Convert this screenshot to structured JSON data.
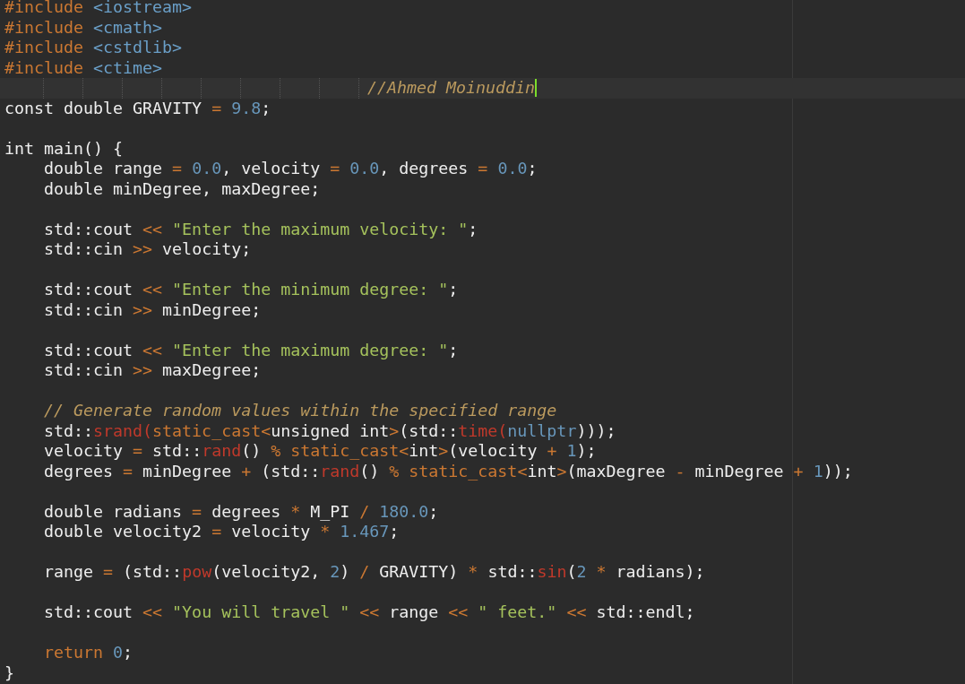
{
  "editor": {
    "lines": [
      {
        "kind": "code",
        "cursor": false,
        "tokens": [
          {
            "kind": "directive",
            "text": "#include "
          },
          {
            "kind": "header",
            "text": "<iostream>"
          }
        ]
      },
      {
        "kind": "code",
        "cursor": false,
        "tokens": [
          {
            "kind": "directive",
            "text": "#include "
          },
          {
            "kind": "header",
            "text": "<cmath>"
          }
        ]
      },
      {
        "kind": "code",
        "cursor": false,
        "tokens": [
          {
            "kind": "directive",
            "text": "#include "
          },
          {
            "kind": "header",
            "text": "<cstdlib>"
          }
        ]
      },
      {
        "kind": "code",
        "cursor": false,
        "tokens": [
          {
            "kind": "directive",
            "text": "#include "
          },
          {
            "kind": "header",
            "text": "<ctime>"
          }
        ]
      },
      {
        "kind": "guided",
        "cursor": true,
        "tokens": [
          {
            "kind": "comment",
            "text": "//Ahmed Moinuddin"
          }
        ]
      },
      {
        "kind": "code",
        "cursor": false,
        "tokens": [
          {
            "kind": "plain",
            "text": "const double GRAVITY"
          },
          {
            "kind": "op",
            "text": " = "
          },
          {
            "kind": "number",
            "text": "9.8"
          },
          {
            "kind": "plain",
            "text": ";"
          }
        ]
      },
      {
        "kind": "blank"
      },
      {
        "kind": "code",
        "cursor": false,
        "tokens": [
          {
            "kind": "plain",
            "text": "int main() {"
          }
        ],
        "children": [
          {
            "kind": "code",
            "cursor": false,
            "tokens": [
              {
                "kind": "plain",
                "text": "double range"
              },
              {
                "kind": "op",
                "text": " = "
              },
              {
                "kind": "number",
                "text": "0.0"
              },
              {
                "kind": "plain",
                "text": ", velocity"
              },
              {
                "kind": "op",
                "text": " = "
              },
              {
                "kind": "number",
                "text": "0.0"
              },
              {
                "kind": "plain",
                "text": ", degrees"
              },
              {
                "kind": "op",
                "text": " = "
              },
              {
                "kind": "number",
                "text": "0.0"
              },
              {
                "kind": "plain",
                "text": ";"
              }
            ]
          },
          {
            "kind": "code",
            "cursor": false,
            "tokens": [
              {
                "kind": "plain",
                "text": "double minDegree, maxDegree;"
              }
            ]
          },
          {
            "kind": "blank"
          },
          {
            "kind": "code",
            "cursor": false,
            "tokens": [
              {
                "kind": "plain",
                "text": "std::cout"
              },
              {
                "kind": "op",
                "text": " << "
              },
              {
                "kind": "string",
                "text": "\"Enter the maximum velocity: \""
              },
              {
                "kind": "plain",
                "text": ";"
              }
            ]
          },
          {
            "kind": "code",
            "cursor": false,
            "tokens": [
              {
                "kind": "plain",
                "text": "std::cin"
              },
              {
                "kind": "op",
                "text": " >> "
              },
              {
                "kind": "plain",
                "text": "velocity;"
              }
            ]
          },
          {
            "kind": "blank"
          },
          {
            "kind": "code",
            "cursor": false,
            "tokens": [
              {
                "kind": "plain",
                "text": "std::cout"
              },
              {
                "kind": "op",
                "text": " << "
              },
              {
                "kind": "string",
                "text": "\"Enter the minimum degree: \""
              },
              {
                "kind": "plain",
                "text": ";"
              }
            ]
          },
          {
            "kind": "code",
            "cursor": false,
            "tokens": [
              {
                "kind": "plain",
                "text": "std::cin"
              },
              {
                "kind": "op",
                "text": " >> "
              },
              {
                "kind": "plain",
                "text": "minDegree;"
              }
            ]
          },
          {
            "kind": "blank"
          },
          {
            "kind": "code",
            "cursor": false,
            "tokens": [
              {
                "kind": "plain",
                "text": "std::cout"
              },
              {
                "kind": "op",
                "text": " << "
              },
              {
                "kind": "string",
                "text": "\"Enter the maximum degree: \""
              },
              {
                "kind": "plain",
                "text": ";"
              }
            ]
          },
          {
            "kind": "code",
            "cursor": false,
            "tokens": [
              {
                "kind": "plain",
                "text": "std::cin"
              },
              {
                "kind": "op",
                "text": " >> "
              },
              {
                "kind": "plain",
                "text": "maxDegree;"
              }
            ]
          },
          {
            "kind": "blank"
          },
          {
            "kind": "code",
            "cursor": false,
            "tokens": [
              {
                "kind": "comment",
                "text": "// Generate random values within the specified range"
              }
            ]
          },
          {
            "kind": "code",
            "cursor": false,
            "tokens": [
              {
                "kind": "plain",
                "text": "std::"
              },
              {
                "kind": "func",
                "text": "srand("
              },
              {
                "kind": "cast",
                "text": "static_cast<"
              },
              {
                "kind": "plain",
                "text": "unsigned int"
              },
              {
                "kind": "cast",
                "text": ">"
              },
              {
                "kind": "plain",
                "text": "(std::"
              },
              {
                "kind": "func",
                "text": "time("
              },
              {
                "kind": "literal",
                "text": "nullptr"
              },
              {
                "kind": "plain",
                "text": ")));"
              }
            ]
          },
          {
            "kind": "code",
            "cursor": false,
            "tokens": [
              {
                "kind": "plain",
                "text": "velocity"
              },
              {
                "kind": "op",
                "text": " = "
              },
              {
                "kind": "plain",
                "text": "std::"
              },
              {
                "kind": "func",
                "text": "rand"
              },
              {
                "kind": "plain",
                "text": "()"
              },
              {
                "kind": "op",
                "text": " % "
              },
              {
                "kind": "cast",
                "text": "static_cast<"
              },
              {
                "kind": "plain",
                "text": "int"
              },
              {
                "kind": "cast",
                "text": ">"
              },
              {
                "kind": "plain",
                "text": "(velocity"
              },
              {
                "kind": "op",
                "text": " + "
              },
              {
                "kind": "number",
                "text": "1"
              },
              {
                "kind": "plain",
                "text": ");"
              }
            ]
          },
          {
            "kind": "code",
            "cursor": false,
            "tokens": [
              {
                "kind": "plain",
                "text": "degrees"
              },
              {
                "kind": "op",
                "text": " = "
              },
              {
                "kind": "plain",
                "text": "minDegree"
              },
              {
                "kind": "op",
                "text": " + "
              },
              {
                "kind": "plain",
                "text": "(std::"
              },
              {
                "kind": "func",
                "text": "rand"
              },
              {
                "kind": "plain",
                "text": "()"
              },
              {
                "kind": "op",
                "text": " % "
              },
              {
                "kind": "cast",
                "text": "static_cast<"
              },
              {
                "kind": "plain",
                "text": "int"
              },
              {
                "kind": "cast",
                "text": ">"
              },
              {
                "kind": "plain",
                "text": "(maxDegree"
              },
              {
                "kind": "op",
                "text": " - "
              },
              {
                "kind": "plain",
                "text": "minDegree"
              },
              {
                "kind": "op",
                "text": " + "
              },
              {
                "kind": "number",
                "text": "1"
              },
              {
                "kind": "plain",
                "text": "));"
              }
            ]
          },
          {
            "kind": "blank"
          },
          {
            "kind": "code",
            "cursor": false,
            "tokens": [
              {
                "kind": "plain",
                "text": "double radians"
              },
              {
                "kind": "op",
                "text": " = "
              },
              {
                "kind": "plain",
                "text": "degrees"
              },
              {
                "kind": "op",
                "text": " * "
              },
              {
                "kind": "plain",
                "text": "M_PI"
              },
              {
                "kind": "op",
                "text": " / "
              },
              {
                "kind": "number",
                "text": "180.0"
              },
              {
                "kind": "plain",
                "text": ";"
              }
            ]
          },
          {
            "kind": "code",
            "cursor": false,
            "tokens": [
              {
                "kind": "plain",
                "text": "double velocity2"
              },
              {
                "kind": "op",
                "text": " = "
              },
              {
                "kind": "plain",
                "text": "velocity"
              },
              {
                "kind": "op",
                "text": " * "
              },
              {
                "kind": "number",
                "text": "1.467"
              },
              {
                "kind": "plain",
                "text": ";"
              }
            ]
          },
          {
            "kind": "blank"
          },
          {
            "kind": "code",
            "cursor": false,
            "tokens": [
              {
                "kind": "plain",
                "text": "range"
              },
              {
                "kind": "op",
                "text": " = "
              },
              {
                "kind": "plain",
                "text": "(std::"
              },
              {
                "kind": "func",
                "text": "pow"
              },
              {
                "kind": "plain",
                "text": "(velocity2, "
              },
              {
                "kind": "number",
                "text": "2"
              },
              {
                "kind": "plain",
                "text": ")"
              },
              {
                "kind": "op",
                "text": " / "
              },
              {
                "kind": "plain",
                "text": "GRAVITY)"
              },
              {
                "kind": "op",
                "text": " * "
              },
              {
                "kind": "plain",
                "text": "std::"
              },
              {
                "kind": "func",
                "text": "sin"
              },
              {
                "kind": "plain",
                "text": "("
              },
              {
                "kind": "number",
                "text": "2"
              },
              {
                "kind": "op",
                "text": " * "
              },
              {
                "kind": "plain",
                "text": "radians);"
              }
            ]
          },
          {
            "kind": "blank"
          },
          {
            "kind": "code",
            "cursor": false,
            "tokens": [
              {
                "kind": "plain",
                "text": "std::cout"
              },
              {
                "kind": "op",
                "text": " << "
              },
              {
                "kind": "string",
                "text": "\"You will travel \""
              },
              {
                "kind": "op",
                "text": " << "
              },
              {
                "kind": "plain",
                "text": "range"
              },
              {
                "kind": "op",
                "text": " << "
              },
              {
                "kind": "string",
                "text": "\" feet.\""
              },
              {
                "kind": "op",
                "text": " << "
              },
              {
                "kind": "plain",
                "text": "std::endl;"
              }
            ]
          },
          {
            "kind": "blank"
          },
          {
            "kind": "code",
            "cursor": false,
            "tokens": [
              {
                "kind": "keyword",
                "text": "return "
              },
              {
                "kind": "number",
                "text": "0"
              },
              {
                "kind": "plain",
                "text": ";"
              }
            ]
          }
        ]
      },
      {
        "kind": "code",
        "cursor": false,
        "tokens": [
          {
            "kind": "plain",
            "text": "}"
          }
        ]
      }
    ]
  }
}
